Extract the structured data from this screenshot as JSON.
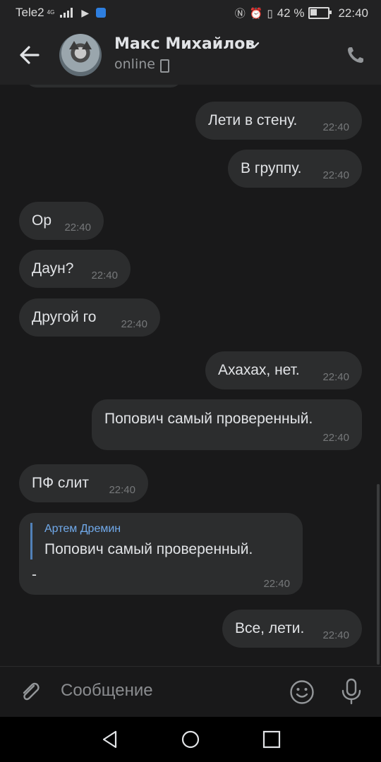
{
  "status_bar": {
    "carrier": "Tele2",
    "network": "4G",
    "battery_text": "42 %",
    "battery_level": 0.42,
    "time": "22:40"
  },
  "header": {
    "contact_name": "Макс Михайлов",
    "presence": "online",
    "back_icon": "arrow-left-icon",
    "call_icon": "phone-icon"
  },
  "messages": [
    {
      "side": "out",
      "text": "Лети в стену.",
      "time": "22:40"
    },
    {
      "side": "out",
      "text": "В группу.",
      "time": "22:40"
    },
    {
      "side": "in",
      "text": "Ор",
      "time": "22:40"
    },
    {
      "side": "in",
      "text": "Даун?",
      "time": "22:40"
    },
    {
      "side": "in",
      "text": "Другой го",
      "time": "22:40"
    },
    {
      "side": "out",
      "text": "Ахахах, нет.",
      "time": "22:40"
    },
    {
      "side": "out",
      "text": "Попович самый проверенный.",
      "time": "22:40"
    },
    {
      "side": "in",
      "text": "ПФ слит",
      "time": "22:40"
    },
    {
      "side": "in",
      "reply_author": "Артем Дремин",
      "reply_text": "Попович самый проверенный.",
      "text": "-",
      "time": "22:40"
    },
    {
      "side": "out",
      "text": "Все, лети.",
      "time": "22:40"
    }
  ],
  "composer": {
    "placeholder": "Сообщение",
    "attach_icon": "paperclip-icon",
    "emoji_icon": "smile-icon",
    "voice_icon": "microphone-icon"
  },
  "navigation": {
    "back_icon": "triangle-back-icon",
    "home_icon": "circle-home-icon",
    "recents_icon": "square-recents-icon"
  },
  "colors": {
    "background": "#19191a",
    "bubble": "#2c2d2e",
    "header": "#222223",
    "accent": "#71aaeb"
  }
}
